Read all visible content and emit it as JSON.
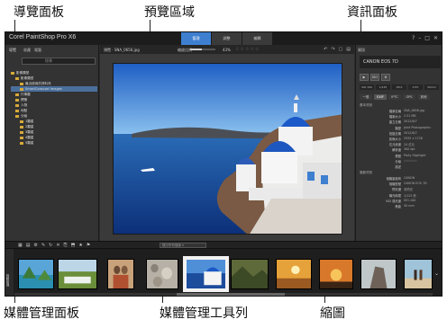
{
  "callouts": {
    "navigation_panel": "導覽面板",
    "preview_area": "預覽區域",
    "info_panel": "資訊面板",
    "organizer_panel": "媒體管理面板",
    "organizer_toolbar": "媒體管理工具列",
    "thumbnails": "縮圖"
  },
  "app": {
    "title": "Corel PaintShop Pro X6",
    "mode_tabs": [
      "管理",
      "調整",
      "編輯"
    ],
    "active_tab": "管理",
    "window_controls": [
      "?",
      "–",
      "□",
      "✕"
    ]
  },
  "nav": {
    "title": "導覽",
    "menus": [
      "收藏",
      "電腦"
    ],
    "search_placeholder": "搜尋",
    "tree": [
      {
        "label": "影像類型",
        "indent": 0
      },
      {
        "label": "影像類型",
        "indent": 1
      },
      {
        "label": "最近使用的資料夾",
        "indent": 2
      },
      {
        "label": "SmartCarousel Images",
        "indent": 2,
        "selected": true
      },
      {
        "label": "行事曆",
        "indent": 1
      },
      {
        "label": "標籤",
        "indent": 1
      },
      {
        "label": "人物",
        "indent": 1
      },
      {
        "label": "地點",
        "indent": 1
      },
      {
        "label": "分級",
        "indent": 1
      },
      {
        "label": "1顆星",
        "indent": 2
      },
      {
        "label": "2顆星",
        "indent": 2
      },
      {
        "label": "3顆星",
        "indent": 2
      },
      {
        "label": "4顆星",
        "indent": 2
      },
      {
        "label": "5顆星",
        "indent": 2
      }
    ]
  },
  "preview": {
    "label": "預覽",
    "filename": "SNA_0656.jpg",
    "zoom_label": "縮放比例",
    "zoom_value": "43%",
    "zoom_fraction": 0.45,
    "stars": "☆☆☆☆☆",
    "view_icons": [
      "↶",
      "↷",
      "▢",
      "▤"
    ]
  },
  "info": {
    "header": "資訊",
    "camera": "CANON EOS 7D",
    "flags": [
      "▶",
      "ISO",
      "⚙"
    ],
    "exif_strip": [
      "ISO 100",
      "1/125",
      "f/8.0",
      "0 EV",
      "50mm"
    ],
    "tabs": [
      "一般",
      "EXIF",
      "IPTC",
      "GPS",
      "其他"
    ],
    "active_tab": "EXIF",
    "section_basic": "基本資訊",
    "basic": [
      {
        "k": "檔案名稱",
        "v": "SNA_0656.jpg"
      },
      {
        "k": "檔案大小",
        "v": "2.51 MB"
      },
      {
        "k": "建立日期",
        "v": "2012/6/7"
      },
      {
        "k": "類型",
        "v": "Joint Photographic"
      },
      {
        "k": "拍攝日期",
        "v": "2012/6/7"
      },
      {
        "k": "影像大小",
        "v": "2592 x 1728"
      },
      {
        "k": "位元深度",
        "v": "24 位元"
      },
      {
        "k": "解析度",
        "v": "300 dpi"
      },
      {
        "k": "標題",
        "v": "Party Highlight"
      },
      {
        "k": "分級",
        "v": "☆☆☆☆☆"
      },
      {
        "k": "描述",
        "v": ""
      }
    ],
    "section_camera": "攝影資訊",
    "camera_rows": [
      {
        "k": "相機製造商",
        "v": "CANON"
      },
      {
        "k": "相機型號",
        "v": "CANON EOS 7D"
      },
      {
        "k": "閃光燈",
        "v": "未閃光"
      },
      {
        "k": "曝光時間",
        "v": "1/125 秒"
      },
      {
        "k": "ISO 感光度",
        "v": "ISO-100"
      },
      {
        "k": "焦距",
        "v": "50 mm"
      }
    ]
  },
  "toolbar": {
    "icons": [
      "▦",
      "▤",
      "⚙",
      "✎",
      "↻",
      "✕",
      "⎘",
      "⬒",
      "★",
      "⚑"
    ],
    "field_label": "顯示所有檔案 ▾"
  },
  "organizer": {
    "side_label": "媒體管理",
    "selected_index": 4,
    "thumbs": [
      {
        "name": "tropical-islands"
      },
      {
        "name": "green-landscape"
      },
      {
        "name": "couple-portrait"
      },
      {
        "name": "pebble-beach"
      },
      {
        "name": "santorini-village"
      },
      {
        "name": "mountain-lake"
      },
      {
        "name": "golden-field"
      },
      {
        "name": "sunset-silhouette"
      },
      {
        "name": "rock-formation"
      },
      {
        "name": "beach-couple"
      }
    ]
  }
}
